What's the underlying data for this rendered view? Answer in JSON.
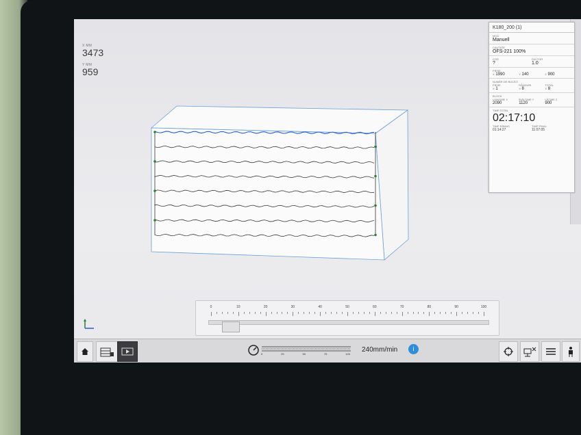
{
  "coordinates": {
    "x": {
      "label": "X MM",
      "value": "3473"
    },
    "y": {
      "label": "Y MM",
      "value": "959"
    }
  },
  "panel": {
    "title": "K180_200 (1)",
    "mode": {
      "label": "MOD",
      "value": "Manuell"
    },
    "material": {
      "label": "CAUTATE",
      "value": "OFS-221 100%"
    },
    "cod": {
      "label": "COD",
      "value": "?"
    },
    "factor": {
      "label": "FACTOR",
      "value": "1.0"
    },
    "piese_dims": {
      "label": "PIESE",
      "x": "1990",
      "y": "140",
      "z": "900",
      "x_axis": "X",
      "y_axis": "Y",
      "z_axis": "Z"
    },
    "counts": {
      "label": "NUMĂR DE BUCĂȚI",
      "piese": {
        "label": "PIESE",
        "value": "1",
        "axis": "X"
      },
      "randuri": {
        "label": "RÂNDURI",
        "value": "8",
        "axis": "X"
      },
      "total": {
        "label": "TOTAL",
        "value": "8",
        "axis": "X"
      }
    },
    "block": {
      "label": "BLOCK",
      "length": {
        "label": "LUNGIME X",
        "value": "2090"
      },
      "height": {
        "label": "ÎNĂLȚIME Y",
        "value": "1120"
      },
      "width": {
        "label": "LĂȚIME Z",
        "value": "900"
      }
    },
    "time": {
      "total_label": "TIMP TOTAL",
      "total": "02:17:10",
      "remaining_label": "TIMP RĂMAS",
      "remaining": "01:14:27",
      "final_label": "TIMP FINAL",
      "final": "11:07:05"
    }
  },
  "slider": {
    "labels": [
      "0",
      "10",
      "20",
      "30",
      "40",
      "50",
      "60",
      "70",
      "80",
      "90",
      "100"
    ],
    "position_percent": 4
  },
  "bottombar": {
    "feed_rate": "240mm/min",
    "info_label": "i",
    "speed_scale": [
      "0",
      "25",
      "50",
      "75",
      "100"
    ]
  },
  "block_view": {
    "cut_lines": 8,
    "active_color": "#2a5bd7",
    "line_color": "#3a3a3a",
    "marker_color": "#2e7d32"
  },
  "colors": {
    "accent": "#2f8fd8"
  }
}
